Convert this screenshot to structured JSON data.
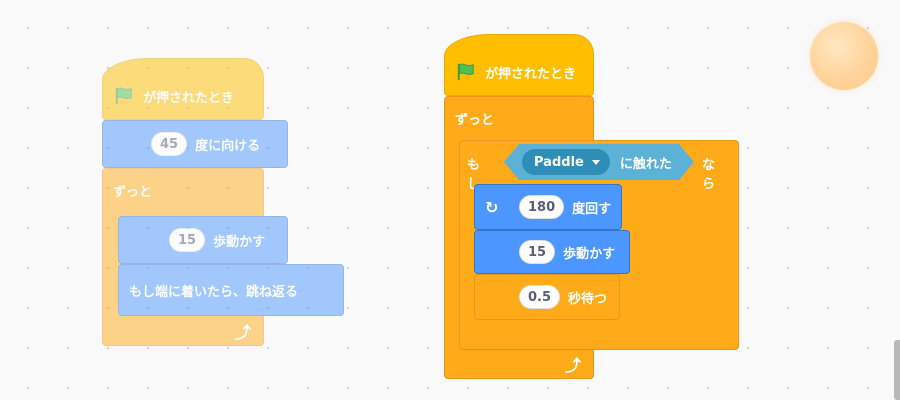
{
  "colors": {
    "events": "#ffbf00",
    "control": "#ffab19",
    "motion": "#4c97ff",
    "sensing": "#5cb1d6",
    "sensing_dark": "#2e8eb8",
    "flag_green": "#4cbf56"
  },
  "script_left": {
    "hat_label": "が押されたとき",
    "point_value": "45",
    "point_label": "度に向ける",
    "forever_label": "ずっと",
    "move_value": "15",
    "move_label": "歩動かす",
    "bounce_label": "もし端に着いたら、跳ね返る",
    "loop_icon": "loop-arrow-icon"
  },
  "script_right": {
    "hat_label": "が押されたとき",
    "forever_label": "ずっと",
    "if_label": "もし",
    "sensor_target": "Paddle",
    "sensor_label": "に触れた",
    "then_label": "なら",
    "turn_icon": "rotate-right-icon",
    "turn_value": "180",
    "turn_label": "度回す",
    "move_value": "15",
    "move_label": "歩動かす",
    "wait_value": "0.5",
    "wait_label": "秒待つ",
    "loop_icon": "loop-arrow-icon"
  }
}
